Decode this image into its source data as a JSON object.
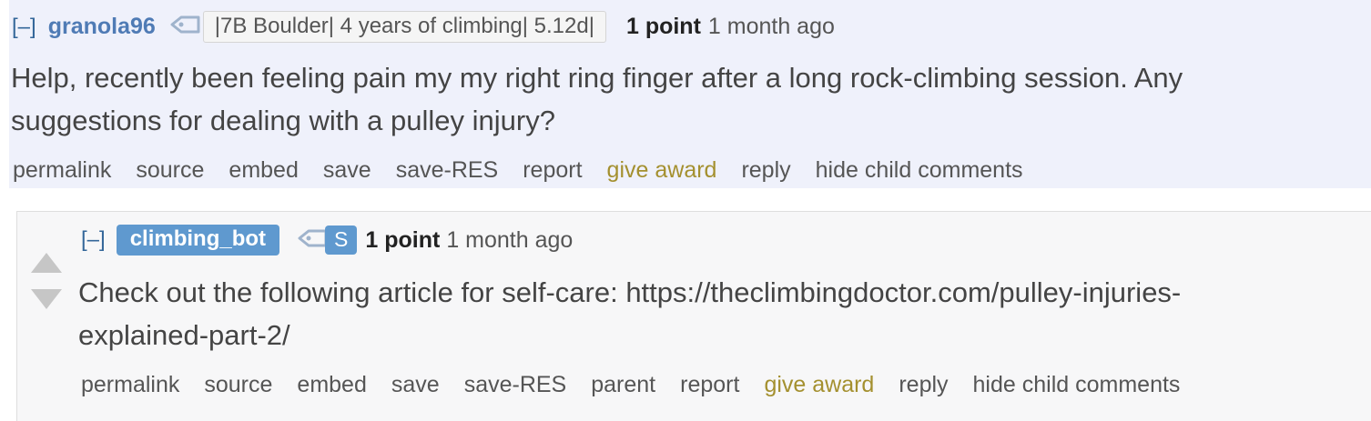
{
  "comment1": {
    "toggle": "[–]",
    "author": "granola96",
    "flair": "|7B Boulder| 4 years of climbing| 5.12d|",
    "score": "1 point",
    "time": "1 month ago",
    "body_line1": "Help, recently been feeling pain my my right ring finger after a long rock-climbing session. Any",
    "body_line2": "suggestions for dealing with a pulley injury?",
    "buttons": [
      "permalink",
      "source",
      "embed",
      "save",
      "save-RES",
      "report",
      "give award",
      "reply",
      "hide child comments"
    ]
  },
  "comment2": {
    "toggle": "[–]",
    "author": "climbing_bot",
    "badge": "S",
    "score": "1 point",
    "time": "1 month ago",
    "body_line1": "Check out the following article for self-care: https://theclimbingdoctor.com/pulley-injuries-",
    "body_line2": "explained-part-2/",
    "buttons": [
      "permalink",
      "source",
      "embed",
      "save",
      "save-RES",
      "parent",
      "report",
      "give award",
      "reply",
      "hide child comments"
    ]
  },
  "colors": {
    "highlight_bg": "#eff1fb",
    "author_link": "#4f7bb5",
    "award": "#a4902f",
    "bot_badge": "#5f99cf"
  }
}
